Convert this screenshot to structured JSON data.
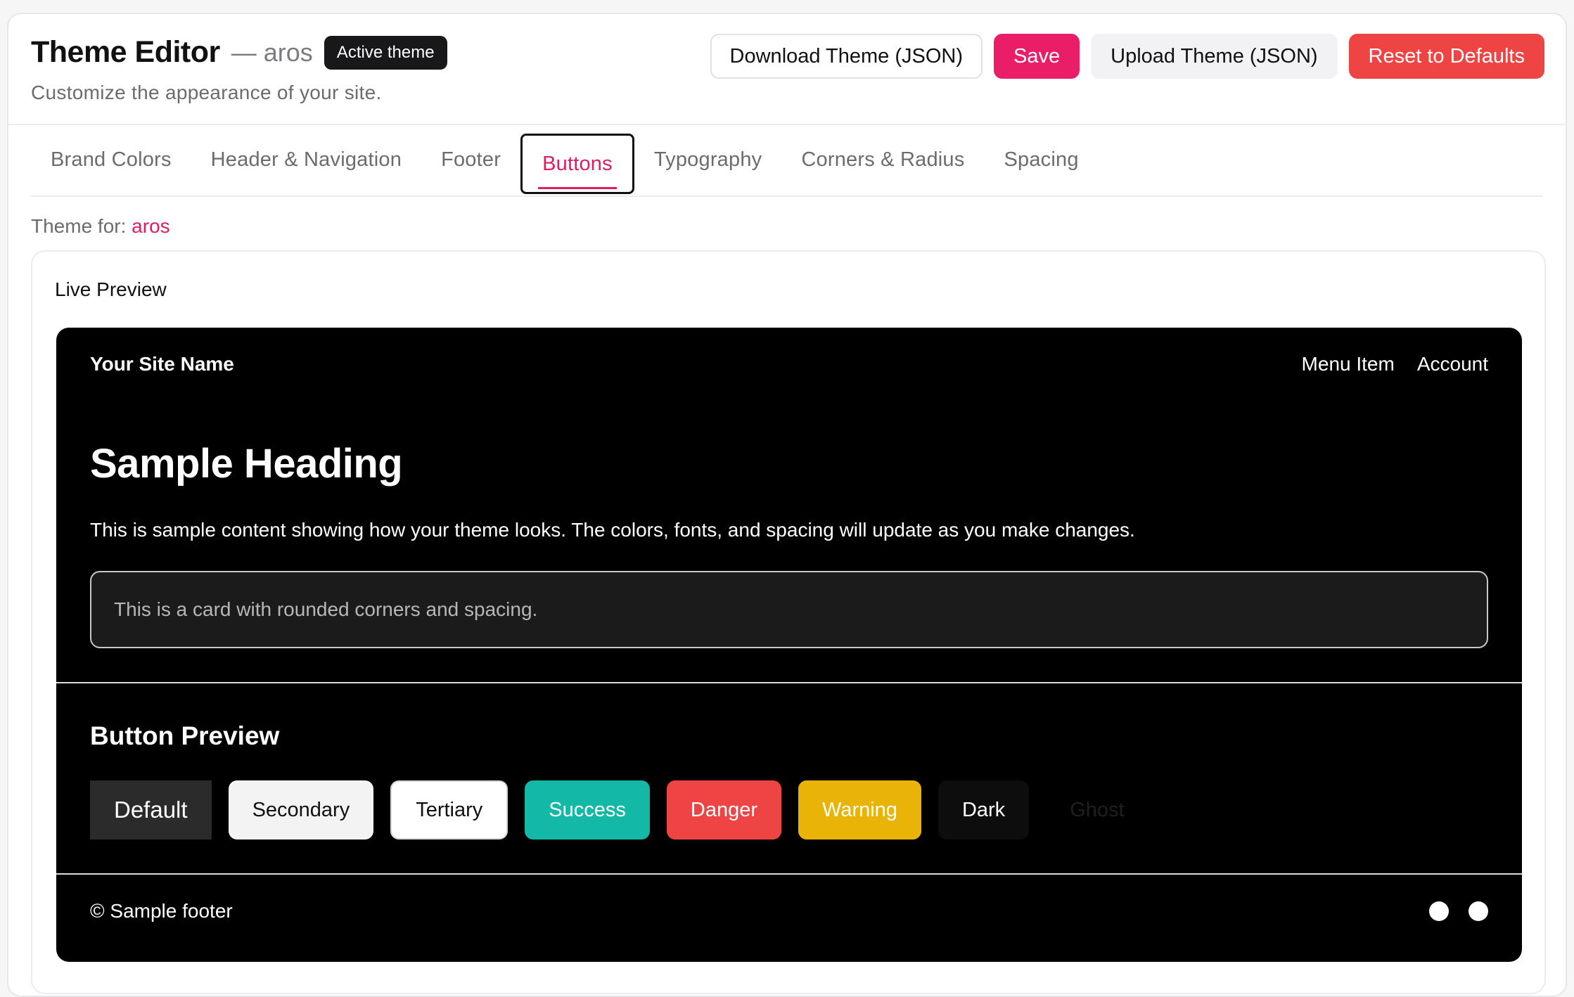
{
  "header": {
    "title": "Theme Editor",
    "site_name": "— aros",
    "badge": "Active theme",
    "subtitle": "Customize the appearance of your site."
  },
  "actions": {
    "download": "Download Theme (JSON)",
    "save": "Save",
    "upload": "Upload Theme (JSON)",
    "reset": "Reset to Defaults"
  },
  "tabs": [
    {
      "label": "Brand Colors"
    },
    {
      "label": "Header & Navigation"
    },
    {
      "label": "Footer"
    },
    {
      "label": "Buttons",
      "active": true
    },
    {
      "label": "Typography"
    },
    {
      "label": "Corners & Radius"
    },
    {
      "label": "Spacing"
    }
  ],
  "theme_for": {
    "label": "Theme for:",
    "value": "aros"
  },
  "preview": {
    "title": "Live Preview",
    "site_brand": "Your Site Name",
    "nav": [
      "Menu Item",
      "Account"
    ],
    "heading": "Sample Heading",
    "text": "This is sample content showing how your theme looks. The colors, fonts, and spacing will update as you make changes.",
    "card_text": "This is a card with rounded corners and spacing.",
    "button_preview_title": "Button Preview",
    "buttons": [
      "Default",
      "Secondary",
      "Tertiary",
      "Success",
      "Danger",
      "Warning",
      "Dark",
      "Ghost"
    ],
    "footer_text": "© Sample footer",
    "footer_icons": [
      "social-icon",
      "social-icon"
    ]
  },
  "colors": {
    "accent": "#e11d5e",
    "save": "#ea1d68",
    "danger": "#ef4444",
    "success": "#14b8a6",
    "warning": "#eab308",
    "preview_bg": "#000000"
  }
}
